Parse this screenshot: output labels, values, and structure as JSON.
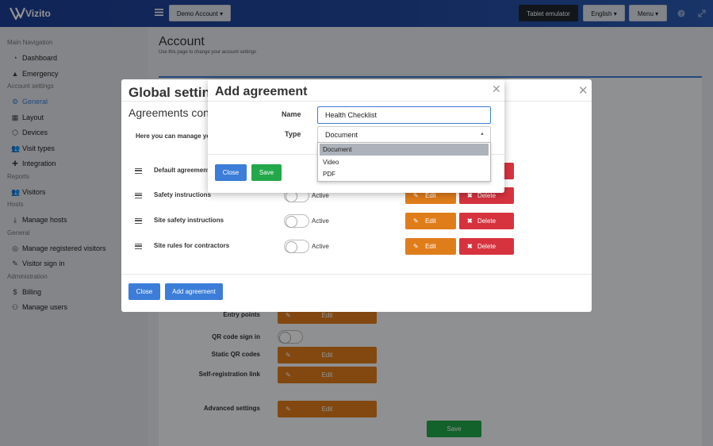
{
  "topbar": {
    "brand": "Vizito",
    "account_btn": "Demo Account ▾",
    "tablet_btn": "Tablet emulator",
    "lang_btn": "English ▾",
    "menu_btn": "Menu ▾"
  },
  "sidebar": {
    "sections": [
      {
        "title": "Main Navigation",
        "items": [
          {
            "label": "Dashboard",
            "icon": "dashboard-icon"
          },
          {
            "label": "Emergency",
            "icon": "warning-icon"
          }
        ]
      },
      {
        "title": "Account settings",
        "items": [
          {
            "label": "General",
            "icon": "gear-icon",
            "active": true
          },
          {
            "label": "Layout",
            "icon": "layout-icon"
          },
          {
            "label": "Devices",
            "icon": "sitemap-icon"
          },
          {
            "label": "Visit types",
            "icon": "users-icon"
          },
          {
            "label": "Integration",
            "icon": "puzzle-icon"
          }
        ]
      },
      {
        "title": "Reports",
        "items": [
          {
            "label": "Visitors",
            "icon": "users-icon"
          }
        ]
      },
      {
        "title": "Hosts",
        "items": [
          {
            "label": "Manage hosts",
            "icon": "download-icon"
          }
        ]
      },
      {
        "title": "General",
        "items": [
          {
            "label": "Manage registered visitors",
            "icon": "target-icon"
          },
          {
            "label": "Visitor sign in",
            "icon": "pencil-icon"
          }
        ]
      },
      {
        "title": "Administration",
        "items": [
          {
            "label": "Billing",
            "icon": "dollar-icon"
          },
          {
            "label": "Manage users",
            "icon": "user-plus-icon"
          }
        ]
      }
    ]
  },
  "page": {
    "title": "Account",
    "subtitle": "Use this page to change your account settings"
  },
  "settings_rows": [
    {
      "label": "Entry points",
      "type": "edit",
      "button": "Edit"
    },
    {
      "label": "QR code sign in",
      "type": "toggle"
    },
    {
      "label": "Static QR codes",
      "type": "edit",
      "button": "Edit"
    },
    {
      "label": "Self-registration link",
      "type": "edit",
      "button": "Edit"
    },
    {
      "label": "Advanced settings",
      "type": "edit",
      "button": "Edit"
    }
  ],
  "main_save": "Save",
  "global_modal": {
    "title": "Global settings",
    "subtitle": "Agreements config",
    "intro": "Here you can manage yo",
    "agreements": [
      {
        "name": "Default agreement",
        "status": "",
        "edit": "",
        "delete": ""
      },
      {
        "name": "Safety instructions",
        "status": "Active",
        "edit": "Edit",
        "delete": "Delete"
      },
      {
        "name": "Site safety instructions",
        "status": "Active",
        "edit": "Edit",
        "delete": "Delete"
      },
      {
        "name": "Site rules for contractors",
        "status": "Active",
        "edit": "Edit",
        "delete": "Delete"
      }
    ],
    "close_btn": "Close",
    "add_btn": "Add agreement"
  },
  "add_modal": {
    "title": "Add agreement",
    "name_label": "Name",
    "name_value": "Health Checklist",
    "type_label": "Type",
    "type_value": "Document",
    "options": [
      "Document",
      "Video",
      "PDF"
    ],
    "highlighted": 0,
    "close_btn": "Close",
    "save_btn": "Save"
  },
  "colors": {
    "primary": "#3b7dd8",
    "edit": "#e07d1b",
    "delete": "#d6333f",
    "save": "#22a84a"
  }
}
